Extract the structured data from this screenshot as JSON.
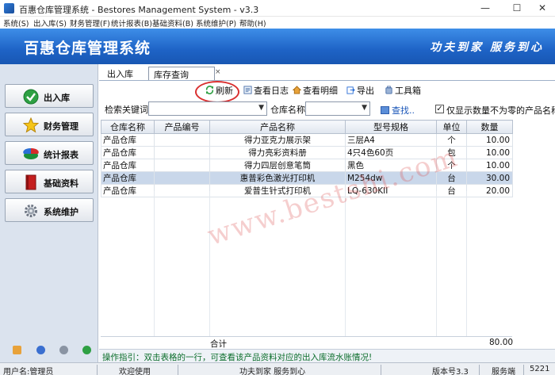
{
  "window": {
    "title": "百惠仓库管理系统 - Bestores Management System - v3.3",
    "minimize": "—",
    "maximize": "☐",
    "close": "✕"
  },
  "menu": [
    "系统(S)",
    "出入库(S)",
    "财务管理(F)",
    "统计报表(B)",
    "基础资料(B)",
    "系统维护(P)",
    "帮助(H)"
  ],
  "banner": {
    "title": "百惠仓库管理系统",
    "slogan": "功夫到家 服务到心"
  },
  "nav": [
    {
      "label": "出入库",
      "icon": "check-icon"
    },
    {
      "label": "财务管理",
      "icon": "star-icon"
    },
    {
      "label": "统计报表",
      "icon": "pie-chart-icon"
    },
    {
      "label": "基础资料",
      "icon": "book-icon"
    },
    {
      "label": "系统维护",
      "icon": "gear-icon"
    }
  ],
  "tabs": [
    "出入库",
    "库存查询"
  ],
  "tab_close": "×",
  "toolbar": {
    "refresh": "刷新",
    "view_log": "查看日志",
    "view_detail": "查看明细",
    "export": "导出",
    "toolbox": "工具箱"
  },
  "filters": {
    "keyword_label": "检索关键词",
    "keyword_value": "",
    "warehouse_label": "仓库名称",
    "warehouse_value": "",
    "find": "查找..",
    "nonzero_checked": "✓",
    "nonzero_label": "仅显示数量不为零的产品名称"
  },
  "table": {
    "columns": [
      "仓库名称",
      "产品编号",
      "产品名称",
      "型号规格",
      "单位",
      "数量"
    ],
    "rows": [
      [
        "产品仓库",
        "",
        "得力亚克力展示架",
        "三层A4",
        "个",
        "10.00"
      ],
      [
        "产品仓库",
        "",
        "得力亮彩资料册",
        "4只4色60页",
        "包",
        "10.00"
      ],
      [
        "产品仓库",
        "",
        "得力四层创意笔筒",
        "黑色",
        "个",
        "10.00"
      ],
      [
        "产品仓库",
        "",
        "惠普彩色激光打印机",
        "M254dw",
        "台",
        "30.00"
      ],
      [
        "产品仓库",
        "",
        "爱普生针式打印机",
        "LQ-630KII",
        "台",
        "20.00"
      ]
    ],
    "selected_row": 3,
    "total_label": "合计",
    "total_value": "80.00"
  },
  "hint": "操作指引：双击表格的一行，可查看该产品资料对应的出入库流水账情况!",
  "status": {
    "user": "用户名:管理员",
    "welcome": "欢迎使用",
    "slogan": "功夫到家 服务到心",
    "version": "版本号3.3",
    "server": "服务端",
    "port": "5221"
  },
  "watermark": "www.bestshi.com",
  "colors": {
    "banner": "#1e63c6",
    "hint_text": "#0c6e2c",
    "highlight_ellipse": "#d93030",
    "selected_row": "#c9d7ea"
  }
}
